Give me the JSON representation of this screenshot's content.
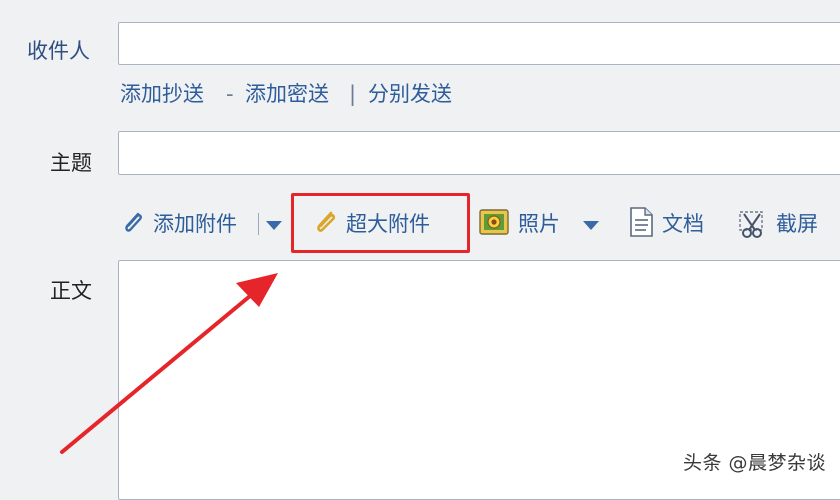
{
  "recipient": {
    "label": "收件人",
    "value": ""
  },
  "cc_links": {
    "add_cc": "添加抄送",
    "separator_1": "-",
    "add_bcc": "添加密送",
    "separator_2": "|",
    "send_separately": "分别发送"
  },
  "subject": {
    "label": "主题",
    "value": ""
  },
  "toolbar": {
    "add_attachment": "添加附件",
    "large_attachment": "超大附件",
    "photo": "照片",
    "document": "文档",
    "screenshot": "截屏"
  },
  "body": {
    "label": "正文",
    "value": ""
  },
  "annotation": {
    "highlight_color": "#e6252a",
    "arrow_color": "#e6252a"
  },
  "watermark": "头条 @晨梦杂谈"
}
